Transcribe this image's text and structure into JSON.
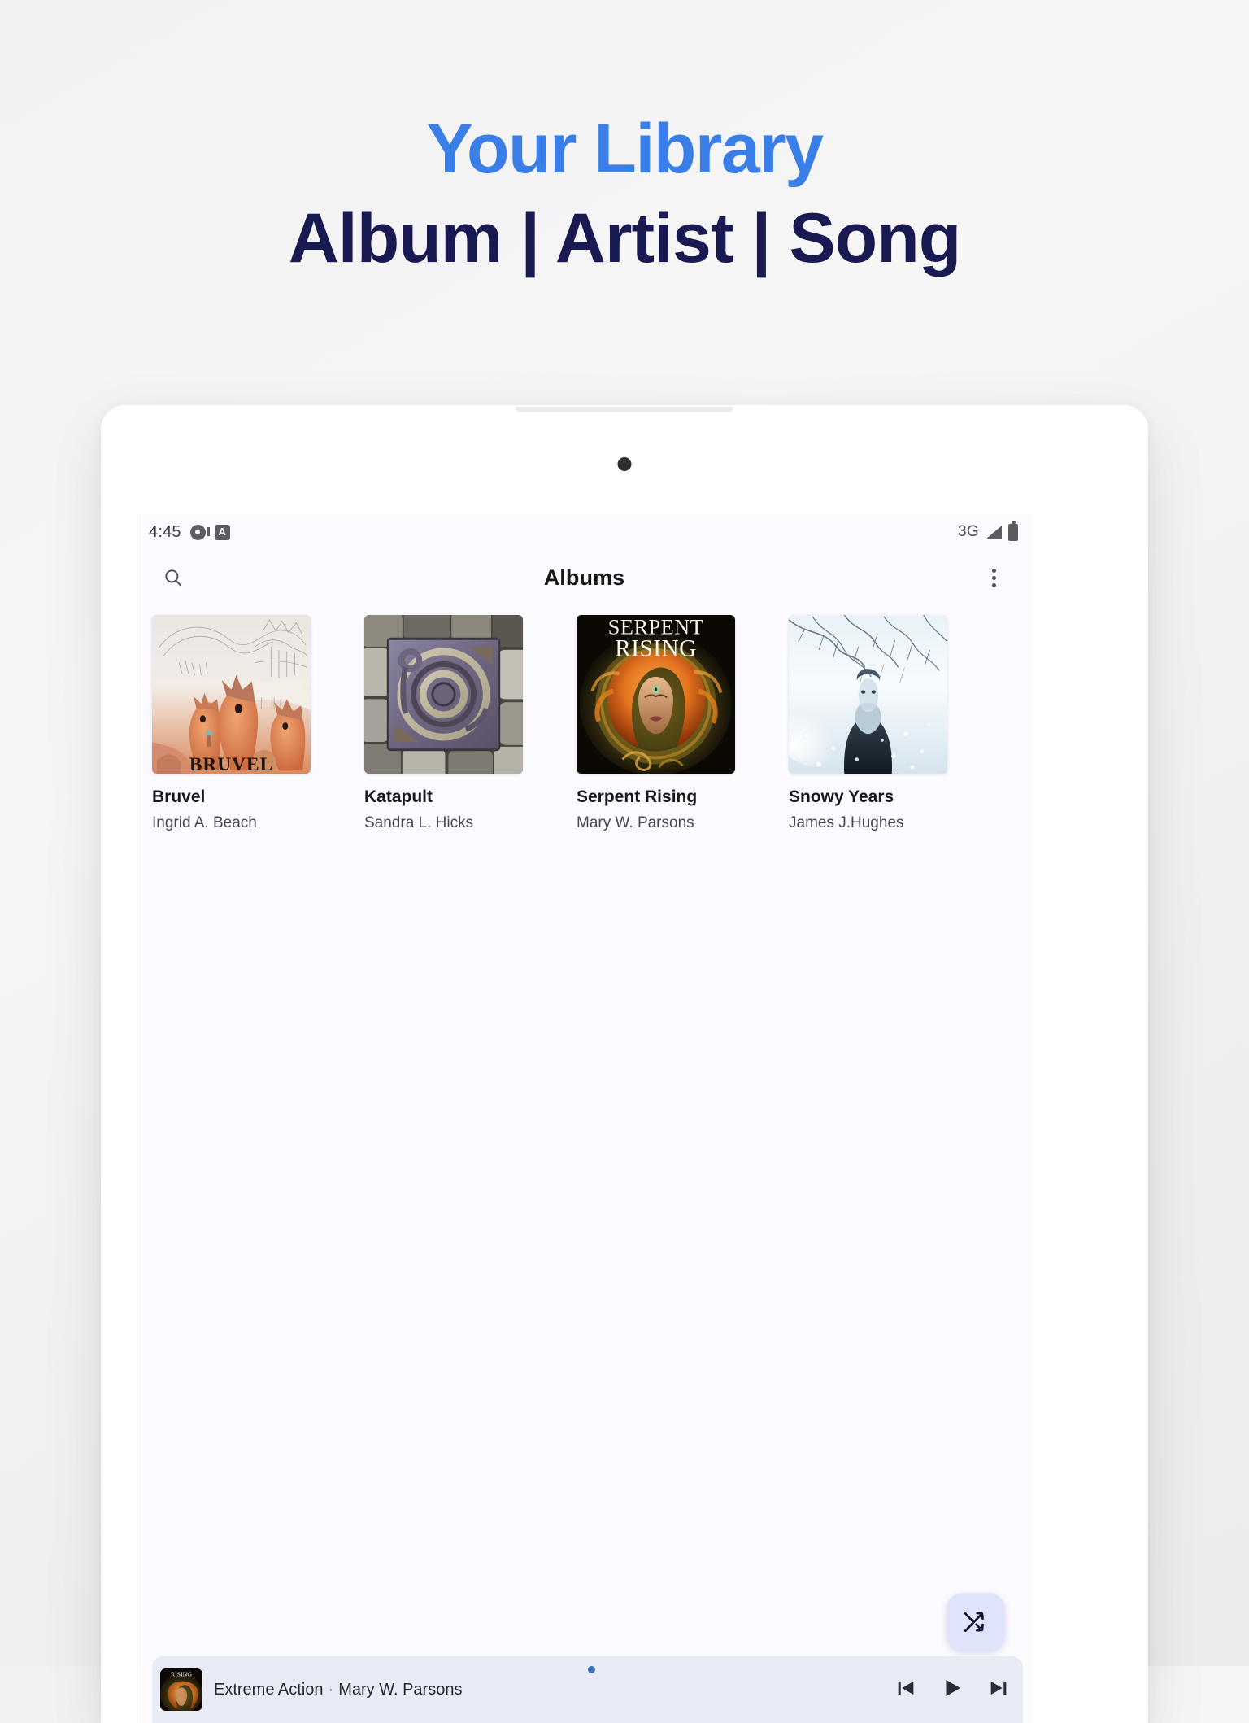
{
  "promo": {
    "line1": "Your Library",
    "line2": "Album | Artist | Song",
    "accent_blue": "#3a7ee8",
    "accent_navy": "#191a52"
  },
  "device": {
    "camera": "front-camera"
  },
  "statusbar": {
    "time": "4:45",
    "music_icon": "disc-icon",
    "app_badge": "A",
    "network": "3G",
    "signal_icon": "signal-icon",
    "battery_icon": "battery-icon"
  },
  "appbar": {
    "title": "Albums",
    "search_icon": "search-icon",
    "more_icon": "overflow-menu-icon"
  },
  "albums": [
    {
      "title": "Bruvel",
      "artist": "Ingrid A. Beach",
      "art": "surreal-orange-horses"
    },
    {
      "title": "Katapult",
      "artist": "Sandra L. Hicks",
      "art": "stone-concentric-rings"
    },
    {
      "title": "Serpent Rising",
      "artist": "Mary W. Parsons",
      "art": "fire-haired-woman",
      "art_text_line1": "SERPENT",
      "art_text_line2": "RISING"
    },
    {
      "title": "Snowy Years",
      "artist": "James J.Hughes",
      "art": "winter-portrait"
    }
  ],
  "fab": {
    "icon": "shuffle-icon",
    "background": "#dfe4fb",
    "icon_color": "#11123a"
  },
  "miniplayer": {
    "track": "Extreme Action",
    "separator": "·",
    "artist": "Mary W. Parsons",
    "art": "fire-haired-woman",
    "prev_icon": "skip-previous-icon",
    "play_icon": "play-icon",
    "next_icon": "skip-next-icon",
    "progress_dot_color": "#3d6fc0"
  }
}
